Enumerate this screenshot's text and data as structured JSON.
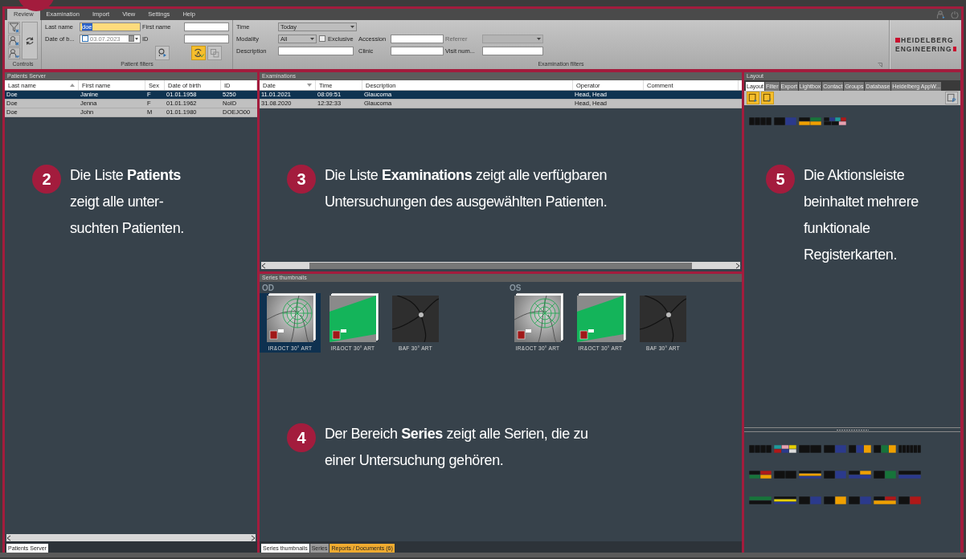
{
  "menu_bar": {
    "tabs": [
      {
        "label": "Review",
        "selected": true
      },
      {
        "label": "Examination",
        "selected": false
      },
      {
        "label": "Import",
        "selected": false
      },
      {
        "label": "View",
        "selected": false
      },
      {
        "label": "Settings",
        "selected": false
      },
      {
        "label": "Help",
        "selected": false
      }
    ]
  },
  "ribbon": {
    "controls": {
      "label": "Controls"
    },
    "patient_filters": {
      "label": "Patient filters",
      "fields": [
        {
          "label": "Last name",
          "kind": "text",
          "value": "doe",
          "active": true
        },
        {
          "label": "First name",
          "kind": "text",
          "active": false
        },
        {
          "label": "Date of b...",
          "kind": "date",
          "value": "03.07.2023",
          "active": false,
          "checked": false
        },
        {
          "label": "ID",
          "kind": "text",
          "active": false
        }
      ],
      "buttons": [
        {
          "active": false
        },
        {
          "active": true
        },
        {
          "active": false
        }
      ]
    },
    "examination_filters": {
      "label": "Examination filters",
      "fields": [
        {
          "label": "Time",
          "kind": "dropdown",
          "value": "Today",
          "disabled": false
        },
        {
          "label": "Modality",
          "kind": "dropdown",
          "value": "All",
          "disabled": false
        },
        {
          "label": "Description",
          "kind": "text",
          "disabled": false
        },
        {
          "label": "Accession",
          "kind": "text",
          "disabled": false
        },
        {
          "label": "Clinic",
          "kind": "text",
          "disabled": false
        },
        {
          "label": "Referrer",
          "kind": "dropdown",
          "disabled": true
        },
        {
          "label": "Visit num...",
          "kind": "text",
          "disabled": false
        }
      ],
      "exclusive": {
        "label": "Exclusive",
        "checked": false
      }
    },
    "logo": [
      "HEIDELBERG",
      "ENGINEERING"
    ]
  },
  "patients": {
    "title": "Patients Server",
    "columns": [
      {
        "label": "Last name",
        "sorted_ascending": true,
        "sorted_descending": false
      },
      {
        "label": "First name",
        "sorted_ascending": false,
        "sorted_descending": false
      },
      {
        "label": "Sex",
        "sorted_ascending": false,
        "sorted_descending": false
      },
      {
        "label": "Date of birth",
        "sorted_ascending": false,
        "sorted_descending": false
      },
      {
        "label": "ID",
        "sorted_ascending": false,
        "sorted_descending": false
      }
    ],
    "rows": [
      {
        "cells": [
          "Doe",
          "Janine",
          "F",
          "01.01.1958",
          "5250"
        ],
        "selected": true
      },
      {
        "cells": [
          "Doe",
          "Jenna",
          "F",
          "01.01.1962",
          "NoID"
        ],
        "selected": false
      },
      {
        "cells": [
          "Doe",
          "John",
          "M",
          "01.01.1980",
          "DOEJO00"
        ],
        "selected": false
      }
    ],
    "tabs": [
      {
        "label": "Patients Server",
        "selected": true
      }
    ]
  },
  "examinations": {
    "title": "Examinations",
    "columns": [
      {
        "label": "Date",
        "sorted_ascending": false,
        "sorted_descending": true
      },
      {
        "label": "Time",
        "sorted_ascending": false,
        "sorted_descending": false
      },
      {
        "label": "Description",
        "sorted_ascending": false,
        "sorted_descending": false
      },
      {
        "label": "Operator",
        "sorted_ascending": false,
        "sorted_descending": false
      },
      {
        "label": "Comment",
        "sorted_ascending": false,
        "sorted_descending": false
      }
    ],
    "rows": [
      {
        "cells": [
          "11.01.2021",
          "08:09:51",
          "Glaucoma",
          "Head, Head",
          null
        ],
        "selected": true
      },
      {
        "cells": [
          "31.08.2020",
          "12:32:33",
          "Glaucoma",
          "Head, Head",
          null
        ],
        "selected": false
      }
    ]
  },
  "series": {
    "title": "Series thumbnails",
    "groups": [
      {
        "label": "OD",
        "thumbnails": [
          {
            "label": "IR&OCT 30° ART",
            "kind": "ir_oct",
            "selected": true
          },
          {
            "label": "IR&OCT 30° ART",
            "kind": "oct_map",
            "selected": false
          },
          {
            "label": "BAF 30° ART",
            "kind": "baf",
            "selected": false
          }
        ]
      },
      {
        "label": "OS",
        "thumbnails": [
          {
            "label": "IR&OCT 30° ART",
            "kind": "ir_oct",
            "selected": false
          },
          {
            "label": "IR&OCT 30° ART",
            "kind": "oct_map",
            "selected": false
          },
          {
            "label": "BAF 30° ART",
            "kind": "baf",
            "selected": false
          }
        ]
      }
    ],
    "tabs": [
      {
        "label": "Series thumbnails",
        "selected": true,
        "highlighted": false
      },
      {
        "label": "Series",
        "selected": false,
        "highlighted": false
      },
      {
        "label": "Reports / Documents (6)",
        "selected": false,
        "highlighted": true
      }
    ]
  },
  "layout_panel": {
    "title": "Layout",
    "tabs": [
      {
        "label": "Layout",
        "selected": true
      },
      {
        "label": "Filter",
        "selected": false
      },
      {
        "label": "Export",
        "selected": false
      },
      {
        "label": "Lightbox",
        "selected": false
      },
      {
        "label": "Contact",
        "selected": false
      },
      {
        "label": "Groups",
        "selected": false
      },
      {
        "label": "Database",
        "selected": false
      },
      {
        "label": "Heidelberg AppW...",
        "selected": false
      }
    ],
    "tools": [
      {
        "active": true
      },
      {
        "active": true
      },
      {
        "active": false
      }
    ]
  },
  "callouts": [
    {
      "number": "2",
      "text": "Die Liste **Patients** zeigt alle unter- suchten Patienten."
    },
    {
      "number": "3",
      "text": "Die Liste **Examinations** zeigt alle verfügbaren Untersuchungen des ausgewählten Patienten."
    },
    {
      "number": "4",
      "text": "Der Bereich **Series** zeigt alle Serien, die zu einer Untersuchung gehören."
    },
    {
      "number": "5",
      "text": "Die Aktionsleiste beinhaltet mehrere funktionale Registerkarten."
    }
  ]
}
